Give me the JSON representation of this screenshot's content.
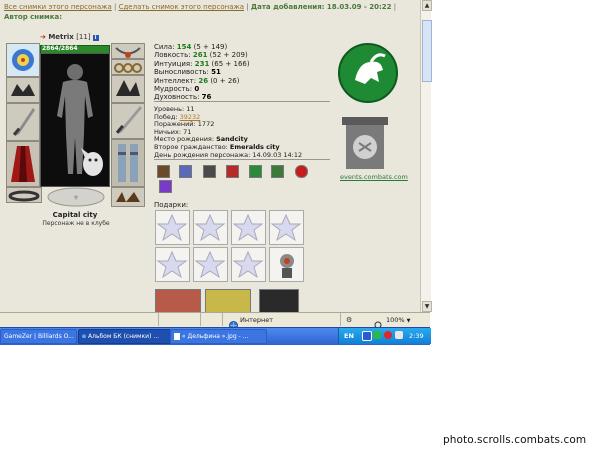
{
  "header": {
    "link_snapshots": "Все снимки этого персонажа",
    "sep1": " | ",
    "link_take": "Сделать снимок этого персонажа",
    "sep2": " | ",
    "date_added": "Дата добавления: 18.03.09 - 20:22",
    "sep3": " | ",
    "author": "Автор снимка:"
  },
  "character": {
    "name": "Metrix",
    "level": "[11]",
    "info_icon": "i",
    "hp": "2864/2864",
    "hp_fraction": 1.0,
    "city": "Capital city",
    "club_status": "Персонаж не в клубе"
  },
  "stats": [
    {
      "label": "Сила: ",
      "value": "154",
      "bonus": " (5 + 149)"
    },
    {
      "label": "Ловкость: ",
      "value": "261",
      "bonus": " (52 + 209)"
    },
    {
      "label": "Интуиция: ",
      "value": "231",
      "bonus": " (65 + 166)"
    },
    {
      "label": "Выносливость: ",
      "value": "51",
      "bonus": ""
    },
    {
      "label": "Интеллект: ",
      "value": "26",
      "bonus": " (0 + 26)"
    },
    {
      "label": "Мудрость: ",
      "value": "0",
      "bonus": ""
    },
    {
      "label": "Духовность: ",
      "value": "76",
      "bonus": ""
    }
  ],
  "info": {
    "level_label": "Уровень: ",
    "level_value": "11",
    "wins_label": "Побед: ",
    "wins_value": "39232",
    "losses_label": "Поражений: ",
    "losses_value": "1772",
    "draws_label": "Ничьих: ",
    "draws_value": "71",
    "birthplace_label": "Место рождения: ",
    "birthplace_value": "Sandcity",
    "second_citizenship_label": "Второе гражданство: ",
    "second_citizenship_value": "Emeralds city",
    "birthday_label": "День рождения персонажа: ",
    "birthday_value": "14.09.03 14:12"
  },
  "guild": {
    "link": "events.combats.com"
  },
  "gifts": {
    "label": "Подарки:"
  },
  "statusbar": {
    "zone": "Интернет",
    "zoom": "100%",
    "zoom_arrow": "▼"
  },
  "taskbar": {
    "buttons": [
      {
        "label": "GameZer | Billiards O..."
      },
      {
        "label": "Альбом БК (снимки) ..."
      },
      {
        "label": "« Дельфина ».jpg - ..."
      }
    ],
    "lang": "EN",
    "clock": "2:39"
  },
  "watermark": "photo.scrolls.combats.com",
  "colors": {
    "content_bg": "#e9e6dc",
    "stat_value": "#1d7a1d",
    "link_gold": "#a87a2a",
    "taskbar_blue": "#2f62cd",
    "tray_blue": "#127fd4"
  },
  "icons": [
    "info-icon",
    "red-arrow-icon",
    "globe-icon",
    "zoom-icon",
    "ie-icon",
    "image-file-icon"
  ]
}
